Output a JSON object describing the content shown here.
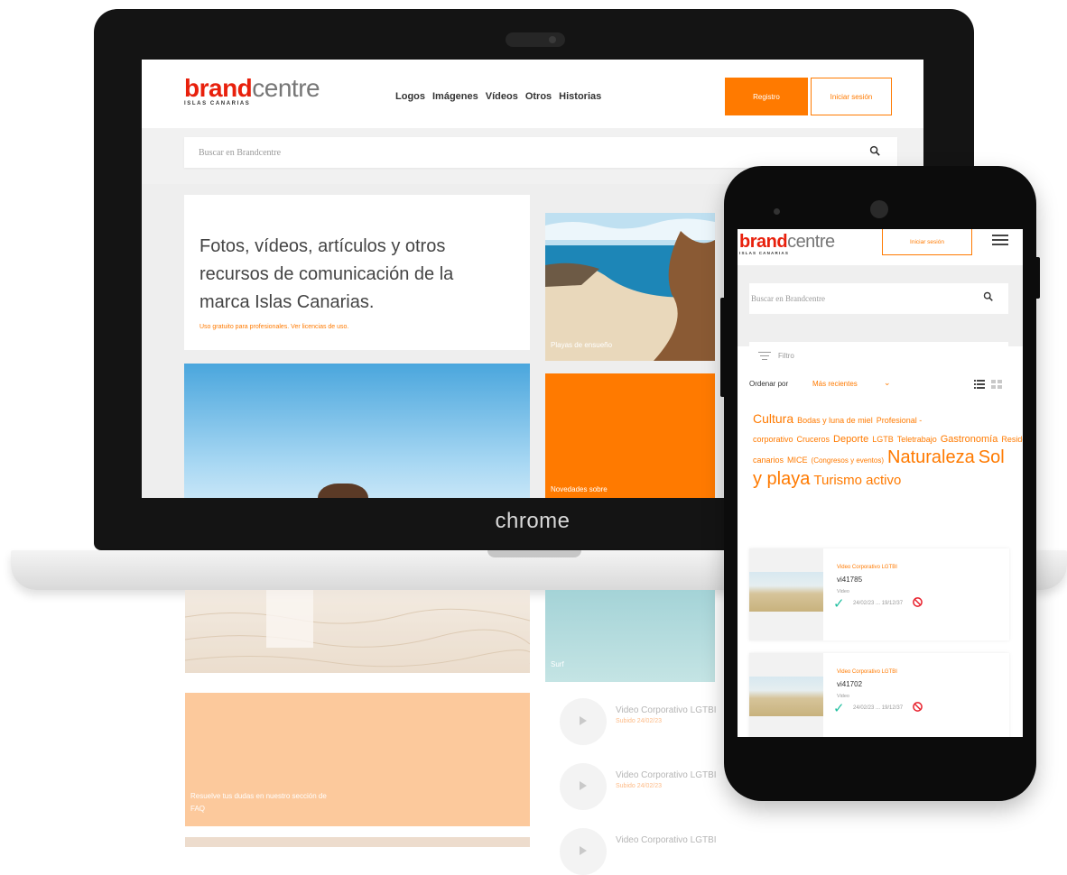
{
  "brand": {
    "strong": "brand",
    "light": "centre",
    "subtitle": "ISLAS CANARIAS"
  },
  "colors": {
    "accent": "#ff7a00",
    "brand_red": "#e8200c",
    "check": "#20bfa0"
  },
  "laptop": {
    "chrome_label": "chrome",
    "nav": [
      "Logos",
      "Imágenes",
      "Vídeos",
      "Otros",
      "Historias"
    ],
    "register_label": "Registro",
    "login_label": "Iniciar sesión",
    "search_placeholder": "Buscar en Brandcentre",
    "hero_title": "Fotos, vídeos, artículos y otros recursos de comunicación de la marca Islas Canarias.",
    "hero_subtitle": "Uso gratuito para profesionales. Ver licencias de uso.",
    "tiles": [
      "Playas de ensueño",
      "Novedades sobre",
      "Surf"
    ],
    "faq_text": "Resuelve tus dudas en nuestro sección de FAQ",
    "videos": [
      {
        "title": "Video Corporativo LGTBI",
        "date": "Subido 24/02/23"
      },
      {
        "title": "Video Corporativo LGTBI",
        "date": "Subido 24/02/23"
      },
      {
        "title": "Video Corporativo LGTBI"
      }
    ]
  },
  "phone": {
    "login_label": "Iniciar sesión",
    "search_placeholder": "Buscar en Brandcentre",
    "filter_placeholder": "Filtro",
    "sort_label": "Ordenar por",
    "sort_value": "Más recientes",
    "tags": [
      {
        "label": "Cultura",
        "size": 14
      },
      {
        "label": "Bodas y luna de miel",
        "size": 9
      },
      {
        "label": "Profesional - corporativo",
        "size": 9
      },
      {
        "label": "Cruceros",
        "size": 9
      },
      {
        "label": "Deporte",
        "size": 11
      },
      {
        "label": "LGTB",
        "size": 9
      },
      {
        "label": "Teletrabajo",
        "size": 9
      },
      {
        "label": "Gastronomía",
        "size": 11
      },
      {
        "label": "Residentes canarios",
        "size": 9
      },
      {
        "label": "MICE",
        "size": 9
      },
      {
        "label": "(Congresos y eventos)",
        "size": 8
      },
      {
        "label": "Naturaleza",
        "size": 20
      },
      {
        "label": "Sol y playa",
        "size": 20
      },
      {
        "label": "Turismo activo",
        "size": 15
      }
    ],
    "cards": [
      {
        "category": "Video Corporativo LGTBI",
        "id": "vi41785",
        "type": "Video",
        "dates": "24/02/23 ... 19/12/37"
      },
      {
        "category": "Video Corporativo LGTBI",
        "id": "vi41702",
        "type": "Video",
        "dates": "24/02/23 ... 19/12/37"
      }
    ]
  }
}
